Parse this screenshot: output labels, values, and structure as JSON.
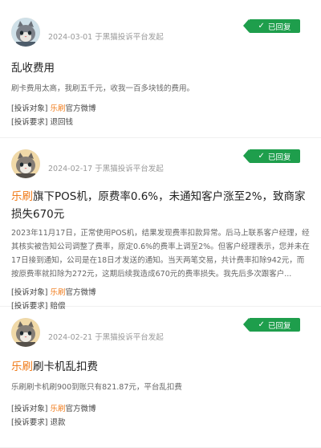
{
  "status": {
    "replied": "已回复"
  },
  "complaints": [
    {
      "date": "2024-03-01",
      "platform": "于黑猫投诉平台发起",
      "title_brand": "",
      "title": "乱收费用",
      "desc": "刷卡费用太高，我刷五千元，收我一百多块钱的费用。",
      "target_label": "[投诉对象]",
      "target_brand": "乐刷",
      "target_rest": "官方微博",
      "demand_label": "[投诉要求]",
      "demand": "退回钱"
    },
    {
      "date": "2024-02-17",
      "platform": "于黑猫投诉平台发起",
      "title_brand": "乐刷",
      "title": "旗下POS机，原费率0.6%，未通知客户涨至2%，致商家损失670元",
      "desc": "2023年11月17日，正常使用POS机，结果发现费率扣款异常。后马上联系客户经理，经其核实被告知公司调整了费率，原定0.6%的费率上调至2%。但客户经理表示，您并未在17日接到通知，公司是在18日才发送的通知。当天两笔交易，共计费率扣除942元，而按原费率就扣除为272元，这期后续我造成670元的费率损失。我先后多次跟客户...",
      "target_label": "[投诉对象]",
      "target_brand": "乐刷",
      "target_rest": "官方微博",
      "demand_label": "[投诉要求]",
      "demand": "赔偿"
    },
    {
      "date": "2024-02-21",
      "platform": "于黑猫投诉平台发起",
      "title_brand": "乐刷",
      "title": "刷卡机乱扣费",
      "desc": "乐刷刷卡机刷900到账只有821.87元，平台乱扣费",
      "target_label": "[投诉对象]",
      "target_brand": "乐刷",
      "target_rest": "官方微博",
      "demand_label": "[投诉要求]",
      "demand": "退款"
    }
  ]
}
